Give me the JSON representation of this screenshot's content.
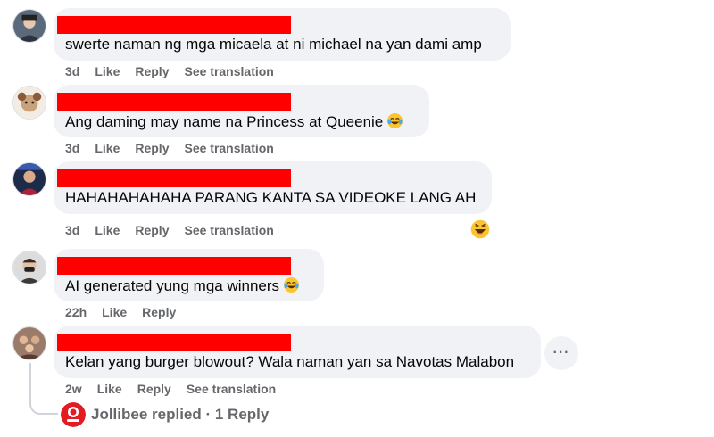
{
  "comments": [
    {
      "text": "swerte naman ng mga micaela at ni michael na yan dami amp",
      "time": "3d",
      "actions": [
        "Like",
        "Reply",
        "See translation"
      ]
    },
    {
      "text": "Ang daming may name na Princess at Queenie",
      "emoji": "laughing-tears",
      "time": "3d",
      "actions": [
        "Like",
        "Reply",
        "See translation"
      ]
    },
    {
      "text": "HAHAHAHAHAHA PARANG KANTA SA VIDEOKE LANG AH",
      "time": "3d",
      "actions": [
        "Like",
        "Reply",
        "See translation"
      ],
      "reaction": "haha"
    },
    {
      "text": "AI generated yung mga winners",
      "emoji": "laughing-tears",
      "time": "22h",
      "actions": [
        "Like",
        "Reply"
      ]
    },
    {
      "text": "Kelan yang burger blowout? Wala naman yan sa Navotas Malabon",
      "time": "2w",
      "actions": [
        "Like",
        "Reply",
        "See translation"
      ],
      "more_label": "···"
    }
  ],
  "reply_summary": {
    "page_name": "Jollibee",
    "text": "Jollibee replied · 1 Reply"
  },
  "colors": {
    "bubble": "#f0f2f5",
    "redaction": "#ff0000",
    "meta_text": "#65676b",
    "body_text": "#050505",
    "brand": "#e31b23"
  },
  "icons": {
    "comment_emoji": "laughing-tears-emoji",
    "reaction": "haha-reaction-icon",
    "more": "more-options-icon",
    "page_logo": "jollibee-logo"
  }
}
